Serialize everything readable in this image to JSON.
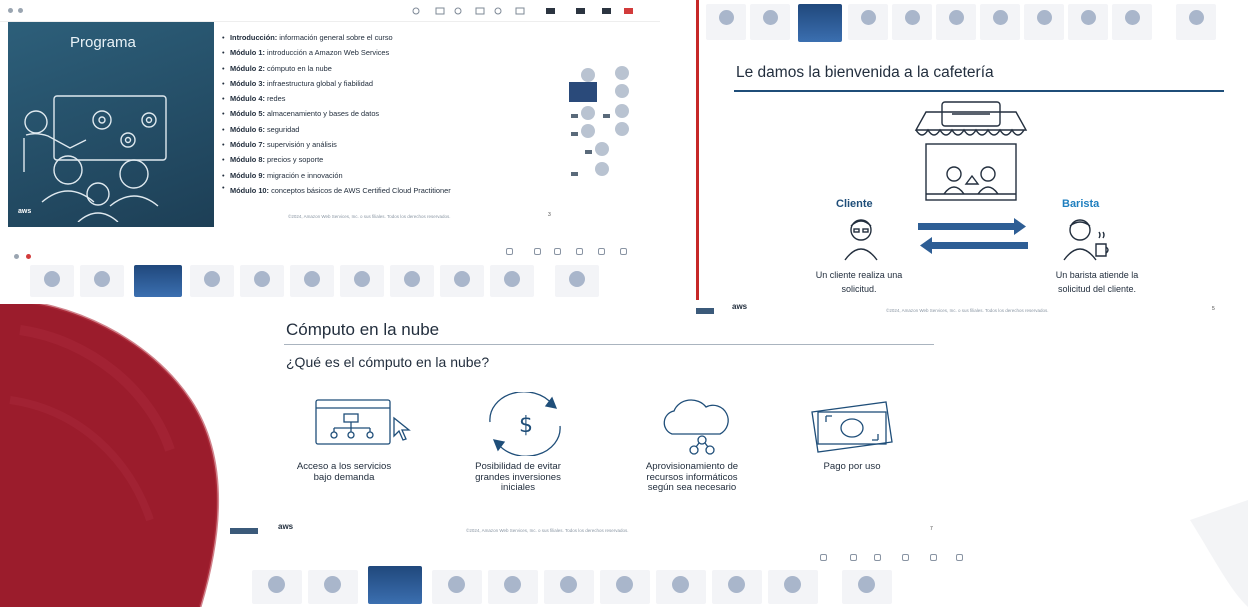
{
  "colors": {
    "maroon": "#9b1c2c",
    "navy": "#232f3e",
    "teal_panel": "#2d5f7a",
    "cliente": "#1f4e79",
    "barista": "#1f7fbf",
    "arrow": "#2e5e95"
  },
  "slide1": {
    "panel_title": "Programa",
    "aws_logo": "aws",
    "bullets": [
      {
        "head": "Introducción",
        "text": " información general sobre el curso",
        "colon": true
      },
      {
        "head": "Módulo 1",
        "text": " introducción a Amazon Web Services",
        "colon": true
      },
      {
        "head": "Módulo 2",
        "text": " cómputo en la nube",
        "colon": true
      },
      {
        "head": "Módulo 3",
        "text": " infraestructura global y fiabilidad",
        "colon": true
      },
      {
        "head": "Módulo 4",
        "text": " redes",
        "colon": true
      },
      {
        "head": "Módulo 5",
        "text": " almacenamiento y bases de datos",
        "colon": true
      },
      {
        "head": "Módulo 6",
        "text": " seguridad",
        "colon": true
      },
      {
        "head": "Módulo 7",
        "text": " supervisión y análisis",
        "colon": true
      },
      {
        "head": "Módulo 8",
        "text": " precios y soporte",
        "colon": true
      },
      {
        "head": "Módulo 9",
        "text": " migración e innovación",
        "colon": true
      },
      {
        "head": "Módulo 10",
        "text": " conceptos básicos de AWS Certified Cloud Practitioner",
        "colon": true
      }
    ],
    "footer": "©2024, Amazon Web Services, Inc. o sus filiales. Todos los derechos reservados.",
    "page": "3"
  },
  "slide2": {
    "title": "Le damos la bienvenida a la cafetería",
    "cliente_label": "Cliente",
    "barista_label": "Barista",
    "cliente_caption_1": "Un cliente realiza una",
    "cliente_caption_2": "solicitud.",
    "barista_caption_1": "Un barista atiende la",
    "barista_caption_2": "solicitud del cliente.",
    "footer": "©2024, Amazon Web Services, Inc. o sus filiales. Todos los derechos reservados.",
    "page": "5",
    "aws_logo": "aws"
  },
  "slide3": {
    "title": "Cómputo en la nube",
    "subtitle": "¿Qué es el cómputo en la nube?",
    "features": [
      {
        "icon": "on-demand-browser-icon",
        "l1": "Acceso a los servicios",
        "l2": "bajo demanda",
        "l3": ""
      },
      {
        "icon": "dollar-cycle-icon",
        "l1": "Posibilidad de evitar",
        "l2": "grandes inversiones",
        "l3": "iniciales"
      },
      {
        "icon": "cloud-network-icon",
        "l1": "Aprovisionamiento de",
        "l2": "recursos informáticos",
        "l3": "según sea necesario"
      },
      {
        "icon": "banknote-icon",
        "l1": "Pago por uso",
        "l2": "",
        "l3": ""
      }
    ],
    "footer": "©2024, Amazon Web Services, Inc. o sus filiales. Todos los derechos reservados.",
    "page": "7",
    "aws_logo": "aws"
  }
}
